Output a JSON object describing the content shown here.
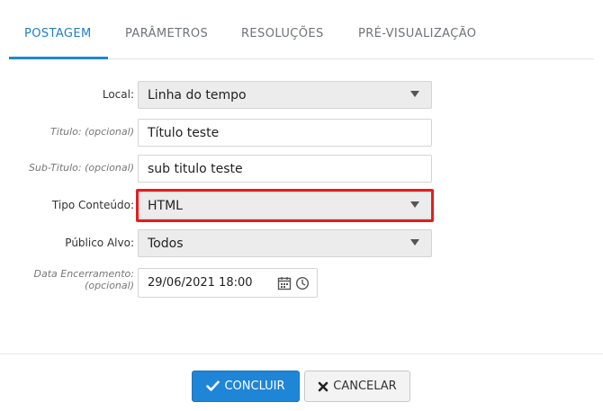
{
  "tabs": [
    {
      "label": "POSTAGEM",
      "active": true
    },
    {
      "label": "PARÂMETROS",
      "active": false
    },
    {
      "label": "RESOLUÇÕES",
      "active": false
    },
    {
      "label": "PRÉ-VISUALIZAÇÃO",
      "active": false
    }
  ],
  "form": {
    "local": {
      "label": "Local:",
      "value": "Linha do tempo"
    },
    "titulo": {
      "label": "Titulo: (opcional)",
      "value": "Título teste"
    },
    "subtitulo": {
      "label": "Sub-Titulo: (opcional)",
      "value": "sub titulo teste"
    },
    "tipo_conteudo": {
      "label": "Tipo Conteúdo:",
      "value": "HTML"
    },
    "publico_alvo": {
      "label": "Público Alvo:",
      "value": "Todos"
    },
    "data_encerramento": {
      "label_line1": "Data Encerramento:",
      "label_line2": "(opcional)",
      "value": "29/06/2021 18:00"
    }
  },
  "footer": {
    "concluir_label": "CONCLUIR",
    "cancelar_label": "CANCELAR"
  },
  "colors": {
    "accent": "#1f85d6",
    "highlight": "#e41e1e"
  },
  "icons": [
    "calendar-icon",
    "clock-icon",
    "check-icon",
    "x-icon",
    "caret-down-icon"
  ]
}
